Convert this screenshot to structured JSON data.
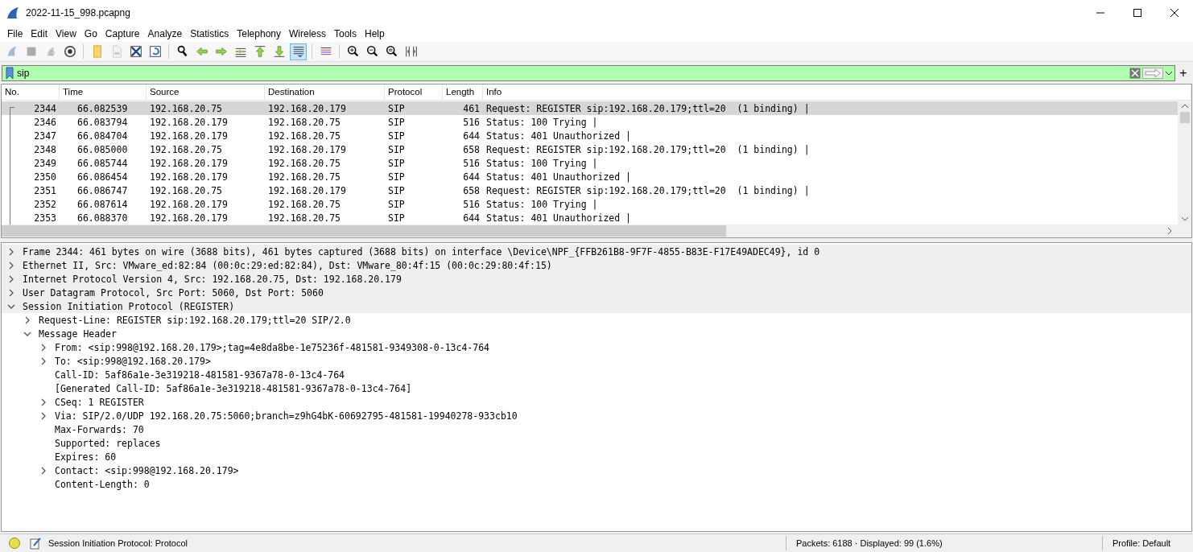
{
  "window": {
    "title": "2022-11-15_998.pcapng"
  },
  "menu": [
    "File",
    "Edit",
    "View",
    "Go",
    "Capture",
    "Analyze",
    "Statistics",
    "Telephony",
    "Wireless",
    "Tools",
    "Help"
  ],
  "toolbar": [
    {
      "kind": "fin",
      "disabled": true,
      "pressed": false
    },
    {
      "kind": "stop",
      "disabled": true,
      "pressed": false
    },
    {
      "kind": "restart",
      "disabled": true,
      "pressed": false
    },
    {
      "kind": "options",
      "disabled": false,
      "pressed": false
    },
    {
      "kind": "sep"
    },
    {
      "kind": "folder",
      "disabled": false,
      "pressed": false
    },
    {
      "kind": "file",
      "disabled": true,
      "pressed": false
    },
    {
      "kind": "closefile",
      "disabled": false,
      "pressed": false
    },
    {
      "kind": "reload",
      "disabled": false,
      "pressed": false
    },
    {
      "kind": "sep"
    },
    {
      "kind": "find",
      "disabled": false,
      "pressed": false
    },
    {
      "kind": "back",
      "disabled": false,
      "pressed": false
    },
    {
      "kind": "forward",
      "disabled": false,
      "pressed": false
    },
    {
      "kind": "goto",
      "disabled": false,
      "pressed": false
    },
    {
      "kind": "first",
      "disabled": false,
      "pressed": false
    },
    {
      "kind": "last",
      "disabled": false,
      "pressed": false
    },
    {
      "kind": "autoscroll",
      "disabled": false,
      "pressed": true
    },
    {
      "kind": "sep"
    },
    {
      "kind": "colorize",
      "disabled": false,
      "pressed": false
    },
    {
      "kind": "sep"
    },
    {
      "kind": "zoomin",
      "disabled": false,
      "pressed": false
    },
    {
      "kind": "zoomout",
      "disabled": false,
      "pressed": false
    },
    {
      "kind": "zoomreset",
      "disabled": false,
      "pressed": false
    },
    {
      "kind": "resize",
      "disabled": false,
      "pressed": false
    }
  ],
  "filter": {
    "value": "sip",
    "add": "+"
  },
  "packet_list": {
    "columns": [
      "No.",
      "Time",
      "Source",
      "Destination",
      "Protocol",
      "Length",
      "Info"
    ],
    "rows": [
      {
        "selected": true,
        "cells": [
          "2344",
          "66.082539",
          "192.168.20.75",
          "192.168.20.179",
          "SIP",
          "461",
          "Request: REGISTER sip:192.168.20.179;ttl=20  (1 binding) |"
        ]
      },
      {
        "selected": false,
        "cells": [
          "2346",
          "66.083794",
          "192.168.20.179",
          "192.168.20.75",
          "SIP",
          "516",
          "Status: 100 Trying |"
        ]
      },
      {
        "selected": false,
        "cells": [
          "2347",
          "66.084704",
          "192.168.20.179",
          "192.168.20.75",
          "SIP",
          "644",
          "Status: 401 Unauthorized |"
        ]
      },
      {
        "selected": false,
        "cells": [
          "2348",
          "66.085000",
          "192.168.20.75",
          "192.168.20.179",
          "SIP",
          "658",
          "Request: REGISTER sip:192.168.20.179;ttl=20  (1 binding) |"
        ]
      },
      {
        "selected": false,
        "cells": [
          "2349",
          "66.085744",
          "192.168.20.179",
          "192.168.20.75",
          "SIP",
          "516",
          "Status: 100 Trying |"
        ]
      },
      {
        "selected": false,
        "cells": [
          "2350",
          "66.086454",
          "192.168.20.179",
          "192.168.20.75",
          "SIP",
          "644",
          "Status: 401 Unauthorized |"
        ]
      },
      {
        "selected": false,
        "cells": [
          "2351",
          "66.086747",
          "192.168.20.75",
          "192.168.20.179",
          "SIP",
          "658",
          "Request: REGISTER sip:192.168.20.179;ttl=20  (1 binding) |"
        ]
      },
      {
        "selected": false,
        "cells": [
          "2352",
          "66.087614",
          "192.168.20.179",
          "192.168.20.75",
          "SIP",
          "516",
          "Status: 100 Trying |"
        ]
      },
      {
        "selected": false,
        "cells": [
          "2353",
          "66.088370",
          "192.168.20.179",
          "192.168.20.75",
          "SIP",
          "644",
          "Status: 401 Unauthorized |"
        ]
      }
    ]
  },
  "details": [
    {
      "text": "Frame 2344: 461 bytes on wire (3688 bits), 461 bytes captured (3688 bits) on interface \\Device\\NPF_{FFB261B8-9F7F-4855-B83E-F17E49ADEC49}, id 0",
      "expanded": false
    },
    {
      "text": "Ethernet II, Src: VMware_ed:82:84 (00:0c:29:ed:82:84), Dst: VMware_80:4f:15 (00:0c:29:80:4f:15)",
      "expanded": false
    },
    {
      "text": "Internet Protocol Version 4, Src: 192.168.20.75, Dst: 192.168.20.179",
      "expanded": false
    },
    {
      "text": "User Datagram Protocol, Src Port: 5060, Dst Port: 5060",
      "expanded": false
    },
    {
      "text": "Session Initiation Protocol (REGISTER)",
      "expanded": true,
      "children": [
        {
          "text": "Request-Line: REGISTER sip:192.168.20.179;ttl=20 SIP/2.0",
          "expanded": false
        },
        {
          "text": "Message Header",
          "expanded": true,
          "children": [
            {
              "text": "From: <sip:998@192.168.20.179>;tag=4e8da8be-1e75236f-481581-9349308-0-13c4-764",
              "expanded": false
            },
            {
              "text": "To: <sip:998@192.168.20.179>",
              "expanded": false
            },
            {
              "text": "Call-ID: 5af86a1e-3e319218-481581-9367a78-0-13c4-764"
            },
            {
              "text": "[Generated Call-ID: 5af86a1e-3e319218-481581-9367a78-0-13c4-764]"
            },
            {
              "text": "CSeq: 1 REGISTER",
              "expanded": false
            },
            {
              "text": "Via: SIP/2.0/UDP 192.168.20.75:5060;branch=z9hG4bK-60692795-481581-19940278-933cb10",
              "expanded": false
            },
            {
              "text": "Max-Forwards: 70"
            },
            {
              "text": "Supported: replaces"
            },
            {
              "text": "Expires: 60"
            },
            {
              "text": "Contact: <sip:998@192.168.20.179>",
              "expanded": false
            },
            {
              "text": "Content-Length: 0"
            }
          ]
        }
      ]
    }
  ],
  "status_bar": {
    "field": "Session Initiation Protocol: Protocol",
    "packets": "Packets: 6188 · Displayed: 99 (1.6%)",
    "profile": "Profile: Default"
  }
}
